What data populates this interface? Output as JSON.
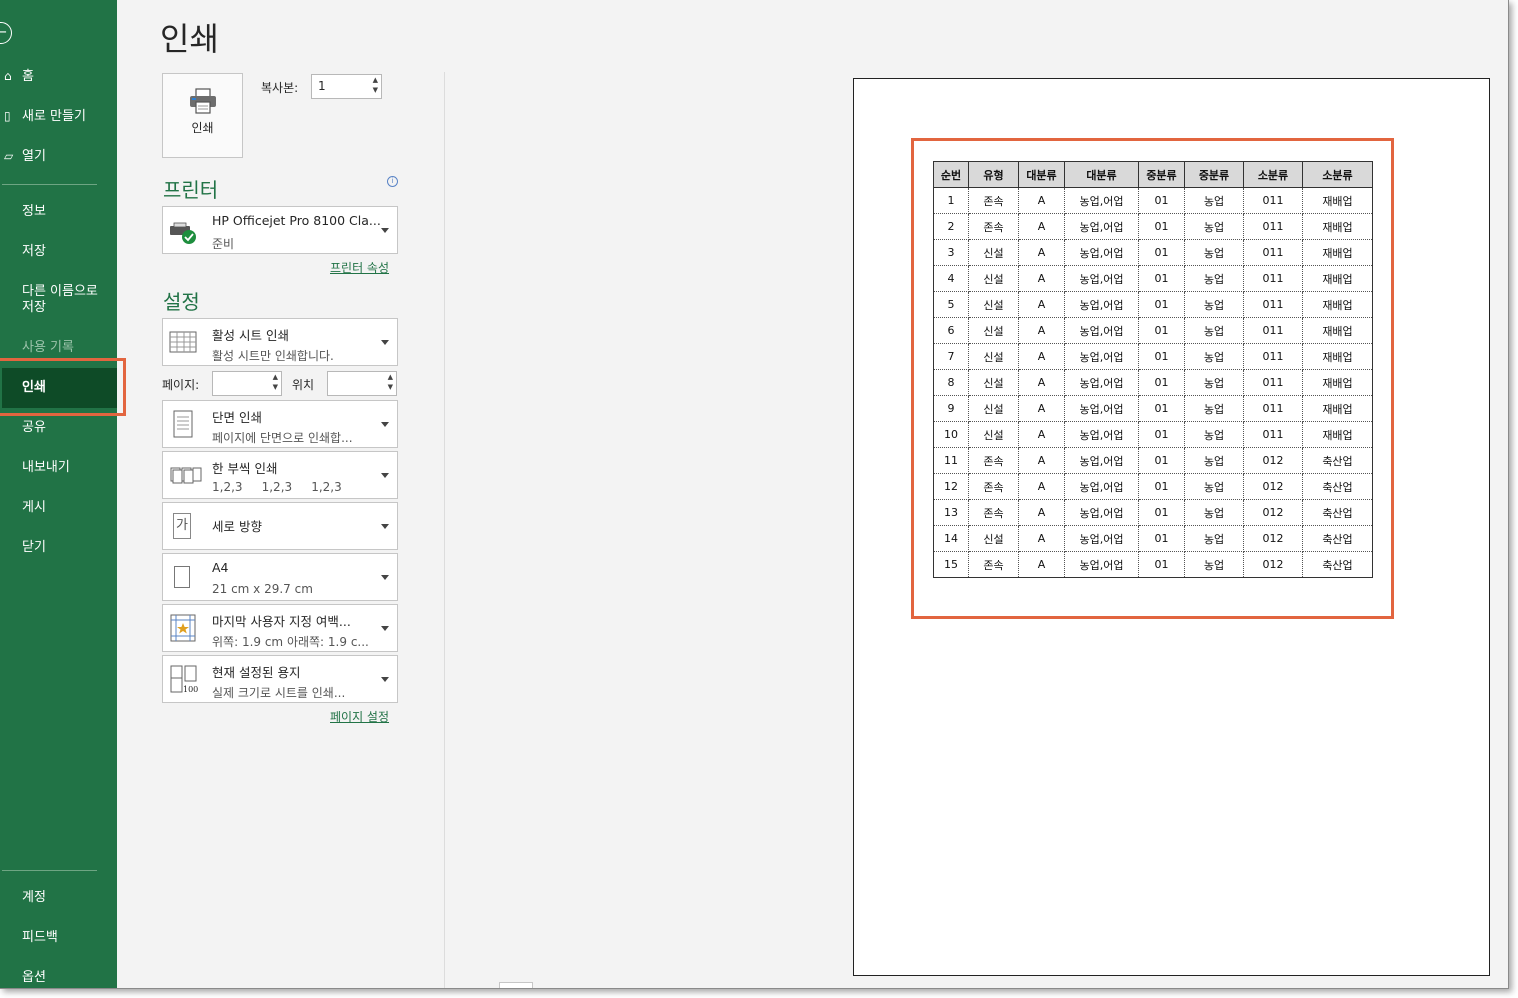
{
  "nav": {
    "back_glyph": "←",
    "home": "홈",
    "new": "새로 만들기",
    "open": "열기",
    "info": "정보",
    "save": "저장",
    "save_as": "다른 이름으로 저장",
    "history": "사용 기록",
    "print": "인쇄",
    "share": "공유",
    "export": "내보내기",
    "publish": "게시",
    "close": "닫기",
    "account": "계정",
    "feedback": "피드백",
    "options": "옵션"
  },
  "page_title": "인쇄",
  "print_button": {
    "label": "인쇄"
  },
  "copies": {
    "label": "복사본:",
    "value": "1"
  },
  "printer": {
    "section_title": "프린터",
    "name": "HP Officejet Pro 8100 Cla...",
    "status": "준비",
    "properties_link": "프린터 속성"
  },
  "settings": {
    "section_title": "설정",
    "scope": {
      "title": "활성 시트 인쇄",
      "sub": "활성 시트만 인쇄합니다."
    },
    "pages_label": "페이지:",
    "pages_value": "",
    "to_label": "위치",
    "to_value": "",
    "sides": {
      "title": "단면 인쇄",
      "sub": "페이지에 단면으로 인쇄합..."
    },
    "collate": {
      "title": "한 부씩 인쇄",
      "sub": "1,2,3     1,2,3     1,2,3"
    },
    "orientation": {
      "title": "세로 방향",
      "icon_char": "가"
    },
    "paper": {
      "title": "A4",
      "sub": "21 cm x 29.7 cm"
    },
    "margins": {
      "title": "마지막 사용자 지정 여백...",
      "sub": "위쪽: 1.9 cm 아래쪽: 1.9 c..."
    },
    "scaling": {
      "title": "현재 설정된 용지",
      "sub": "실제 크기로 시트를 인쇄...",
      "icon_num": "100"
    },
    "page_setup_link": "페이지 설정"
  },
  "preview_table": {
    "headers": [
      "순번",
      "유형",
      "대분류",
      "대분류",
      "중분류",
      "중분류",
      "소분류",
      "소분류"
    ],
    "rows": [
      [
        "1",
        "존속",
        "A",
        "농업,어업",
        "01",
        "농업",
        "011",
        "재배업"
      ],
      [
        "2",
        "존속",
        "A",
        "농업,어업",
        "01",
        "농업",
        "011",
        "재배업"
      ],
      [
        "3",
        "신설",
        "A",
        "농업,어업",
        "01",
        "농업",
        "011",
        "재배업"
      ],
      [
        "4",
        "신설",
        "A",
        "농업,어업",
        "01",
        "농업",
        "011",
        "재배업"
      ],
      [
        "5",
        "신설",
        "A",
        "농업,어업",
        "01",
        "농업",
        "011",
        "재배업"
      ],
      [
        "6",
        "신설",
        "A",
        "농업,어업",
        "01",
        "농업",
        "011",
        "재배업"
      ],
      [
        "7",
        "신설",
        "A",
        "농업,어업",
        "01",
        "농업",
        "011",
        "재배업"
      ],
      [
        "8",
        "신설",
        "A",
        "농업,어업",
        "01",
        "농업",
        "011",
        "재배업"
      ],
      [
        "9",
        "신설",
        "A",
        "농업,어업",
        "01",
        "농업",
        "011",
        "재배업"
      ],
      [
        "10",
        "신설",
        "A",
        "농업,어업",
        "01",
        "농업",
        "011",
        "재배업"
      ],
      [
        "11",
        "존속",
        "A",
        "농업,어업",
        "01",
        "농업",
        "012",
        "축산업"
      ],
      [
        "12",
        "존속",
        "A",
        "농업,어업",
        "01",
        "농업",
        "012",
        "축산업"
      ],
      [
        "13",
        "존속",
        "A",
        "농업,어업",
        "01",
        "농업",
        "012",
        "축산업"
      ],
      [
        "14",
        "신설",
        "A",
        "농업,어업",
        "01",
        "농업",
        "012",
        "축산업"
      ],
      [
        "15",
        "존속",
        "A",
        "농업,어업",
        "01",
        "농업",
        "012",
        "축산업"
      ]
    ]
  },
  "colors": {
    "nav_bg": "#217346",
    "nav_selected": "#0e4b27",
    "highlight": "#e2653f",
    "accent": "#217346"
  }
}
